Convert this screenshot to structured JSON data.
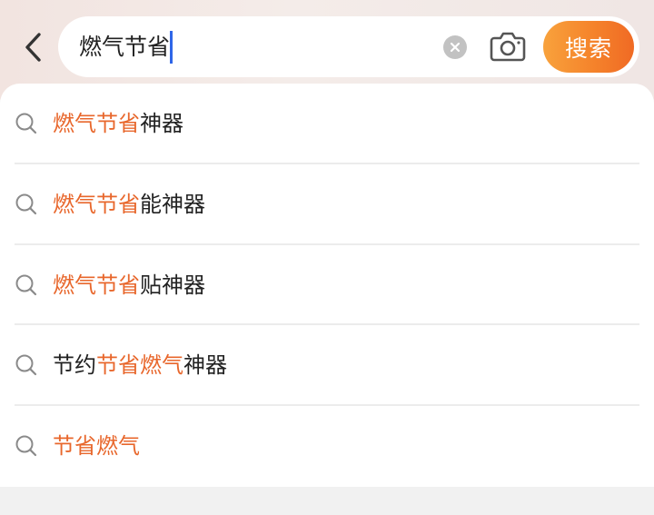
{
  "search": {
    "query": "燃气节省",
    "search_button_label": "搜索"
  },
  "suggestions": [
    {
      "parts": [
        {
          "text": "燃气节省",
          "highlight": true
        },
        {
          "text": "神器",
          "highlight": false
        }
      ]
    },
    {
      "parts": [
        {
          "text": "燃气节省",
          "highlight": true
        },
        {
          "text": "能神器",
          "highlight": false
        }
      ]
    },
    {
      "parts": [
        {
          "text": "燃气节省",
          "highlight": true
        },
        {
          "text": "贴神器",
          "highlight": false
        }
      ]
    },
    {
      "parts": [
        {
          "text": "节约",
          "highlight": false
        },
        {
          "text": "节省燃气",
          "highlight": true
        },
        {
          "text": "神器",
          "highlight": false
        }
      ]
    },
    {
      "parts": [
        {
          "text": "节省燃气",
          "highlight": true
        }
      ]
    }
  ],
  "icons": {
    "back": "chevron-left-icon",
    "clear": "clear-circle-icon",
    "camera": "camera-icon",
    "suggestion": "search-icon"
  },
  "colors": {
    "highlight": "#e8672c",
    "search_button_start": "#f8a23c",
    "search_button_end": "#f06a24",
    "caret": "#2f66e8"
  }
}
